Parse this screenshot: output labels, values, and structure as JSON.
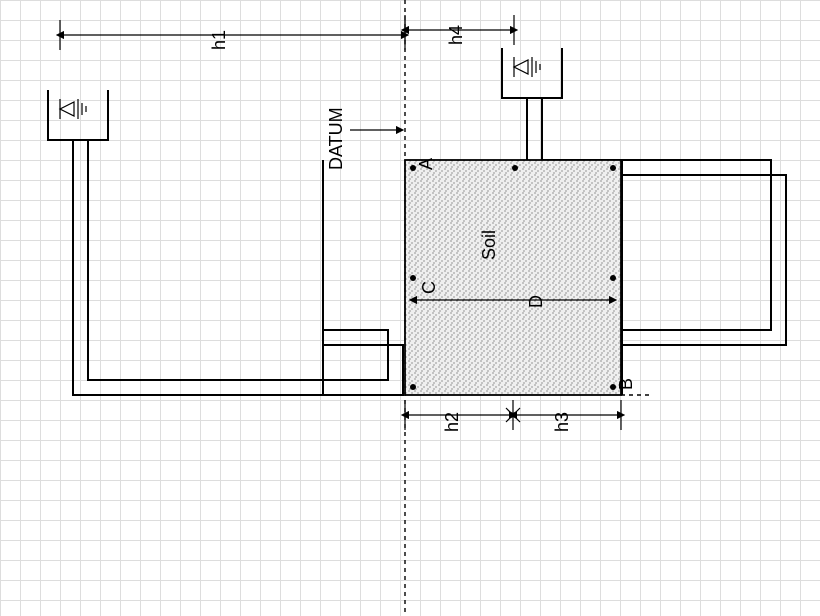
{
  "labels": {
    "h1": "h1",
    "h2": "h2",
    "h3": "h3",
    "h4": "h4",
    "datum": "DATUM",
    "soil": "Soil",
    "A": "A",
    "B": "B",
    "C": "C",
    "D": "D"
  },
  "geometry_note": "Engineering soil permeameter / seepage diagram. Left reservoir connects via pipe to bottom of a soil column; right reservoir connects via pipe to top of soil column. DATUM line at top of soil. h1 = head of left reservoir above datum. h4 = head of right reservoir above datum. h2 = top half of soil column height (datum to mid). h3 = bottom half. D = soil column height (≈ h2+h3). A = top-right corner of soil, B = bottom-right, C = mid-left point of soil."
}
